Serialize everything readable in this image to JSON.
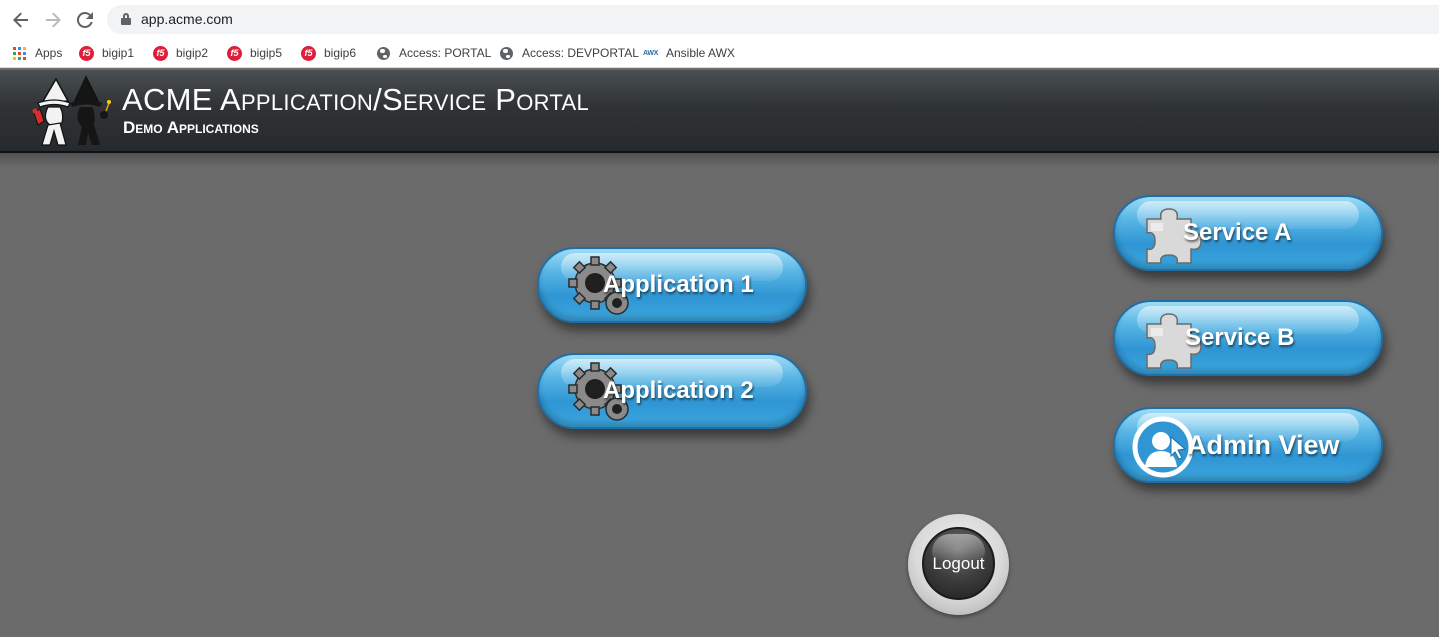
{
  "browser": {
    "url": "app.acme.com",
    "bookmarks": [
      {
        "label": "Apps",
        "icon": "apps-grid-icon"
      },
      {
        "label": "bigip1",
        "icon": "f5-logo-icon"
      },
      {
        "label": "bigip2",
        "icon": "f5-logo-icon"
      },
      {
        "label": "bigip5",
        "icon": "f5-logo-icon"
      },
      {
        "label": "bigip6",
        "icon": "f5-logo-icon"
      },
      {
        "label": "Access: PORTAL",
        "icon": "globe-icon"
      },
      {
        "label": "Access: DEVPORTAL",
        "icon": "globe-icon"
      },
      {
        "label": "Ansible AWX",
        "icon": "awx-logo-icon",
        "icon_text": "AWX"
      }
    ]
  },
  "header": {
    "title": "ACME Application/Service Portal",
    "subtitle": "Demo Applications"
  },
  "applications": [
    {
      "label": "Application 1",
      "icon": "gears-icon"
    },
    {
      "label": "Application 2",
      "icon": "gears-icon"
    }
  ],
  "services": [
    {
      "label": "Service A",
      "icon": "puzzle-piece-icon"
    },
    {
      "label": "Service B",
      "icon": "puzzle-piece-icon"
    },
    {
      "label": "Admin View",
      "icon": "user-admin-icon"
    }
  ],
  "logout": {
    "label": "Logout"
  },
  "colors": {
    "page_background": "#6b6b6b",
    "header_background": "#2f3335",
    "button_blue": "#3ba6de"
  }
}
